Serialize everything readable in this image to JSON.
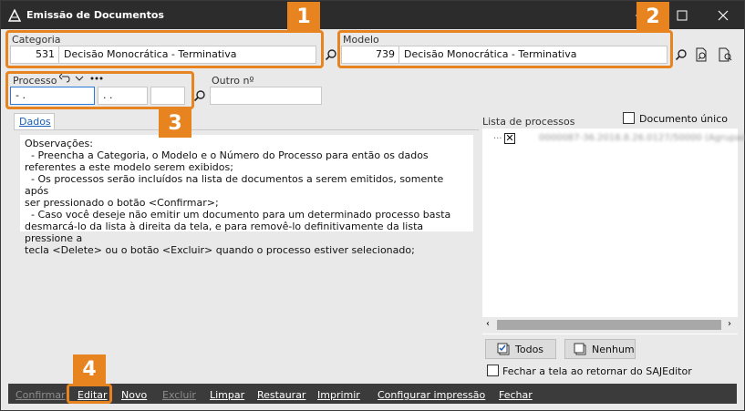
{
  "window": {
    "title": "Emissão de Documentos"
  },
  "categoria": {
    "label": "Categoria",
    "code": "531",
    "name": "Decisão Monocrática - Terminativa"
  },
  "modelo": {
    "label": "Modelo",
    "code": "739",
    "name": "Decisão Monocrática - Terminativa"
  },
  "processo": {
    "label": "Processo",
    "part1": "-  .",
    "part2": ".  .",
    "part3": ""
  },
  "outro": {
    "label": "Outro nº",
    "value": ""
  },
  "tabs": {
    "dados": "Dados"
  },
  "observacoes": "Observações:\n  - Preencha a Categoria, o Modelo e o Número do Processo para então os dados\nreferentes a este modelo serem exibidos;\n  - Os processos serão incluídos na lista de documentos a serem emitidos, somente após\nser pressionado o botão <Confirmar>;\n  - Caso você deseje não emitir um documento para um determinado processo basta\ndesmarcá-lo da lista à direita da tela, e para removê-lo definitivamente da lista pressione a\ntecla <Delete> ou o botão <Excluir> quando o processo estiver selecionado;",
  "lista": {
    "label": "Lista de processos",
    "documento_unico": "Documento único",
    "item": "0000087-36.2018.8.26.0127/50000 (Agrupado)"
  },
  "buttons": {
    "todos": "Todos",
    "nenhum": "Nenhum"
  },
  "fechar_tela": "Fechar a tela ao retornar do SAJEditor",
  "footer": {
    "confirmar": "Confirmar",
    "editar": "Editar",
    "novo": "Novo",
    "excluir": "Excluir",
    "limpar": "Limpar",
    "restaurar": "Restaurar",
    "imprimir": "Imprimir",
    "configurar": "Configurar impressão",
    "fechar": "Fechar"
  },
  "badges": [
    "1",
    "2",
    "3",
    "4"
  ],
  "colors": {
    "highlight": "#e8841f",
    "titlebar": "#2c2c2c"
  }
}
